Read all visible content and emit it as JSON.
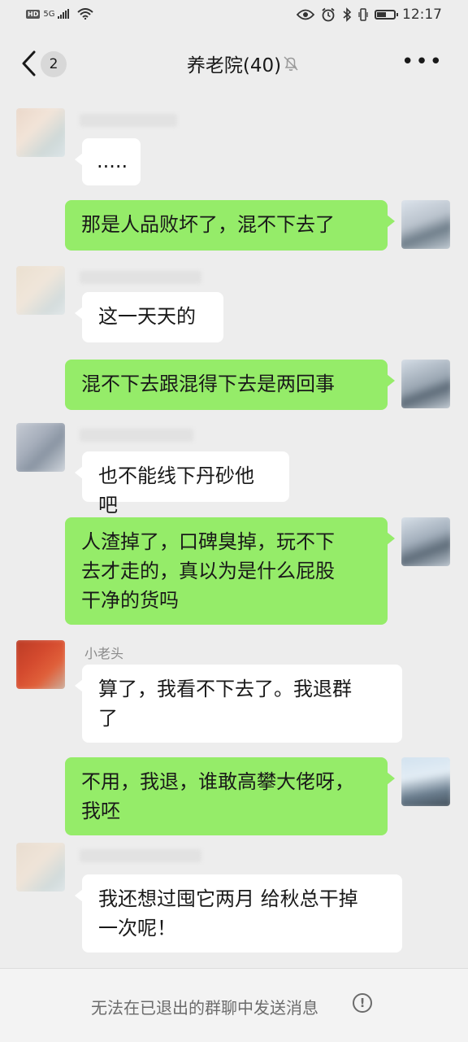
{
  "status_bar": {
    "hd": "HD",
    "network": "5G",
    "time": "12:17",
    "battery_level": 0.55
  },
  "header": {
    "badge_count": "2",
    "title": "养老院(40)"
  },
  "messages": [
    {
      "side": "in",
      "text": "....."
    },
    {
      "side": "out",
      "text": "那是人品败坏了，混不下去了"
    },
    {
      "side": "in",
      "text": "这一天天的"
    },
    {
      "side": "out",
      "text": "混不下去跟混得下去是两回事"
    },
    {
      "side": "in",
      "text": "也不能线下丹砂他吧"
    },
    {
      "side": "out",
      "text": "人渣掉了，口碑臭掉，玩不下\n去才走的，真以为是什么屁股\n干净的货吗"
    },
    {
      "side": "in",
      "sender": "小老头",
      "text": "算了，我看不下去了。我退群\n了"
    },
    {
      "side": "out",
      "text": "不用，我退，谁敢高攀大佬呀，\n我呸"
    },
    {
      "side": "in",
      "text": "我还想过囤它两月 给秋总干掉\n一次呢！"
    }
  ],
  "footer": {
    "notice": "无法在已退出的群聊中发送消息"
  },
  "colors": {
    "background": "#ededed",
    "outgoing_bubble": "#95ec69",
    "incoming_bubble": "#ffffff"
  }
}
